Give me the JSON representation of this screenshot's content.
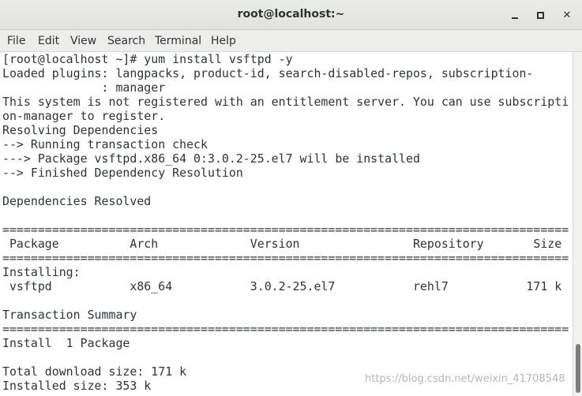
{
  "window": {
    "title": "root@localhost:~",
    "minimize_icon": "minimize-icon",
    "maximize_icon": "maximize-icon",
    "close_icon": "close-icon"
  },
  "menu": [
    "File",
    "Edit",
    "View",
    "Search",
    "Terminal",
    "Help"
  ],
  "terminal": {
    "lines": [
      "[root@localhost ~]# yum install vsftpd -y",
      "Loaded plugins: langpacks, product-id, search-disabled-repos, subscription-",
      "              : manager",
      "This system is not registered with an entitlement server. You can use subscripti",
      "on-manager to register.",
      "Resolving Dependencies",
      "--> Running transaction check",
      "---> Package vsftpd.x86_64 0:3.0.2-25.el7 will be installed",
      "--> Finished Dependency Resolution",
      "",
      "Dependencies Resolved",
      "",
      "================================================================================",
      " Package          Arch             Version                Repository       Size",
      "================================================================================",
      "Installing:",
      " vsftpd           x86_64           3.0.2-25.el7           rehl7           171 k",
      "",
      "Transaction Summary",
      "================================================================================",
      "Install  1 Package",
      "",
      "Total download size: 171 k",
      "Installed size: 353 k"
    ]
  },
  "watermark": "https://blog.csdn.net/weixin_41708548"
}
